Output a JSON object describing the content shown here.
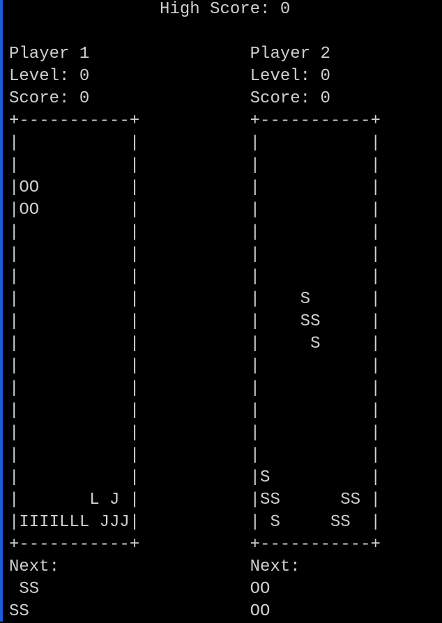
{
  "high_score_line": "               High Score: 0",
  "rows": [
    "",
    "Player 1                Player 2",
    "Level: 0                Level: 0",
    "Score: 0                Score: 0",
    "+-----------+           +-----------+",
    "|           |           |           |",
    "|           |           |           |",
    "|OO         |           |           |",
    "|OO         |           |           |",
    "|           |           |           |",
    "|           |           |           |",
    "|           |           |           |",
    "|           |           |    S      |",
    "|           |           |    SS     |",
    "|           |           |     S     |",
    "|           |           |           |",
    "|           |           |           |",
    "|           |           |           |",
    "|           |           |           |",
    "|           |           |           |",
    "|           |           |S          |",
    "|       L J |           |SS      SS |",
    "|IIIILLL JJJ|           | S     SS  |",
    "+-----------+           +-----------+",
    "Next:                   Next:",
    " SS                     OO",
    "SS                      OO"
  ],
  "colors": {
    "background": "#000000",
    "text": "#cfcfcf",
    "window_edge": "#1f5bd6"
  }
}
